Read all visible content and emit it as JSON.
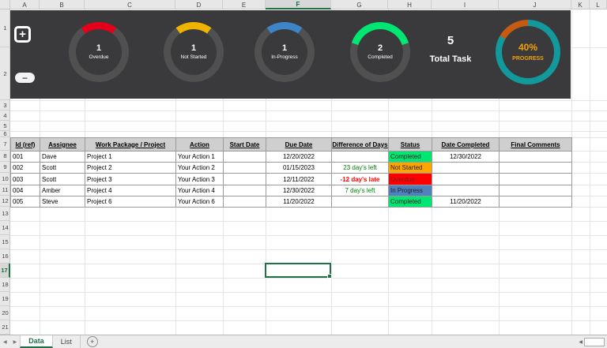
{
  "grid": {
    "column_headers": [
      "A",
      "B",
      "C",
      "D",
      "E",
      "F",
      "G",
      "H",
      "I",
      "J",
      "K",
      "L"
    ],
    "row_headers": [
      "1",
      "2",
      "3",
      "4",
      "5",
      "6",
      "7",
      "8",
      "9",
      "10",
      "11",
      "12",
      "13",
      "14",
      "15",
      "16",
      "17",
      "18",
      "19",
      "20",
      "21"
    ],
    "selected_column": "F",
    "selected_row": "17",
    "selection_color": "#1e7145"
  },
  "icons": {
    "plus": "+",
    "minus": "−",
    "tab_prev": "◀",
    "tab_next": "▶",
    "new_sheet": "+",
    "scroll_left": "◀"
  },
  "dashboard": {
    "background": "#3a3a3c",
    "ring_gray": "#505050",
    "gauges": [
      {
        "value": "1",
        "label": "Overdue",
        "color": "#e50019",
        "percent": 20
      },
      {
        "value": "1",
        "label": "Not Started",
        "color": "#f0b400",
        "percent": 20
      },
      {
        "value": "1",
        "label": "In-Progress",
        "color": "#3d85c8",
        "percent": 20
      },
      {
        "value": "2",
        "label": "Completed",
        "color": "#00e673",
        "percent": 40
      }
    ],
    "total": {
      "value": "5",
      "label": "Total Task"
    },
    "progress": {
      "percent_label": "40%",
      "label": "PROGRESS",
      "ring_color": "#12999b",
      "accent_color": "#c55a11",
      "text_color": "#f2a10a",
      "accent_start_deg": 300
    }
  },
  "table": {
    "headers": [
      "Id (ref)",
      "Assignee",
      "Work Package / Project",
      "Action",
      "Start Date",
      "Due Date",
      "Difference of Days",
      "Status",
      "Date Completed",
      "Final Comments"
    ],
    "rows": [
      {
        "id": "001",
        "assignee": "Dave",
        "project": "Project 1",
        "action": "Your Action 1",
        "start": "",
        "due": "12/20/2022",
        "diff": "",
        "diff_color": "",
        "diff_bold": false,
        "status": "Completed",
        "status_bg": "#00e673",
        "status_fg": "#1f1f1f",
        "completed": "12/30/2022",
        "comments": ""
      },
      {
        "id": "002",
        "assignee": "Scott",
        "project": "Project 2",
        "action": "Your Action 2",
        "start": "",
        "due": "01/15/2023",
        "diff": "23 day's left",
        "diff_color": "#008000",
        "diff_bold": false,
        "status": "Not Started",
        "status_bg": "#ffa500",
        "status_fg": "#1f1f1f",
        "completed": "",
        "comments": ""
      },
      {
        "id": "003",
        "assignee": "Scott",
        "project": "Project 3",
        "action": "Your Action 3",
        "start": "",
        "due": "12/11/2022",
        "diff": "-12 day's late",
        "diff_color": "#ff0000",
        "diff_bold": true,
        "status": "Overdue",
        "status_bg": "#ff0000",
        "status_fg": "#7a2020",
        "completed": "",
        "comments": ""
      },
      {
        "id": "004",
        "assignee": "Amber",
        "project": "Project 4",
        "action": "Your Action 4",
        "start": "",
        "due": "12/30/2022",
        "diff": "7 day's left",
        "diff_color": "#008000",
        "diff_bold": false,
        "status": "In Progress",
        "status_bg": "#4f81bd",
        "status_fg": "#1f1f1f",
        "completed": "",
        "comments": ""
      },
      {
        "id": "005",
        "assignee": "Steve",
        "project": "Project 6",
        "action": "Your Action 6",
        "start": "",
        "due": "11/20/2022",
        "diff": "",
        "diff_color": "",
        "diff_bold": false,
        "status": "Completed",
        "status_bg": "#00e673",
        "status_fg": "#1f1f1f",
        "completed": "11/20/2022",
        "comments": ""
      }
    ]
  },
  "app": {
    "sheet_tabs": [
      {
        "label": "Data",
        "active": true
      },
      {
        "label": "List",
        "active": false
      }
    ]
  }
}
